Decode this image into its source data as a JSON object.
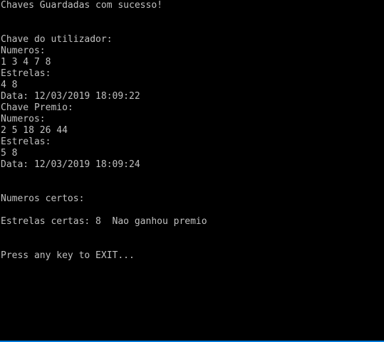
{
  "console": {
    "colors": {
      "background": "#000000",
      "text": "#c0c0c0",
      "bottom_edge": "#0078d7"
    },
    "lines": [
      "Chaves Guardadas com sucesso!",
      "",
      "",
      "Chave do utilizador:",
      "Numeros:",
      "1 3 4 7 8",
      "Estrelas:",
      "4 8",
      "Data: 12/03/2019 18:09:22",
      "Chave Premio:",
      "Numeros:",
      "2 5 18 26 44",
      "Estrelas:",
      "5 8",
      "Data: 12/03/2019 18:09:24",
      "",
      "",
      "Numeros certos:",
      "",
      "Estrelas certas: 8  Nao ganhou premio",
      "",
      "",
      "Press any key to EXIT..."
    ]
  }
}
